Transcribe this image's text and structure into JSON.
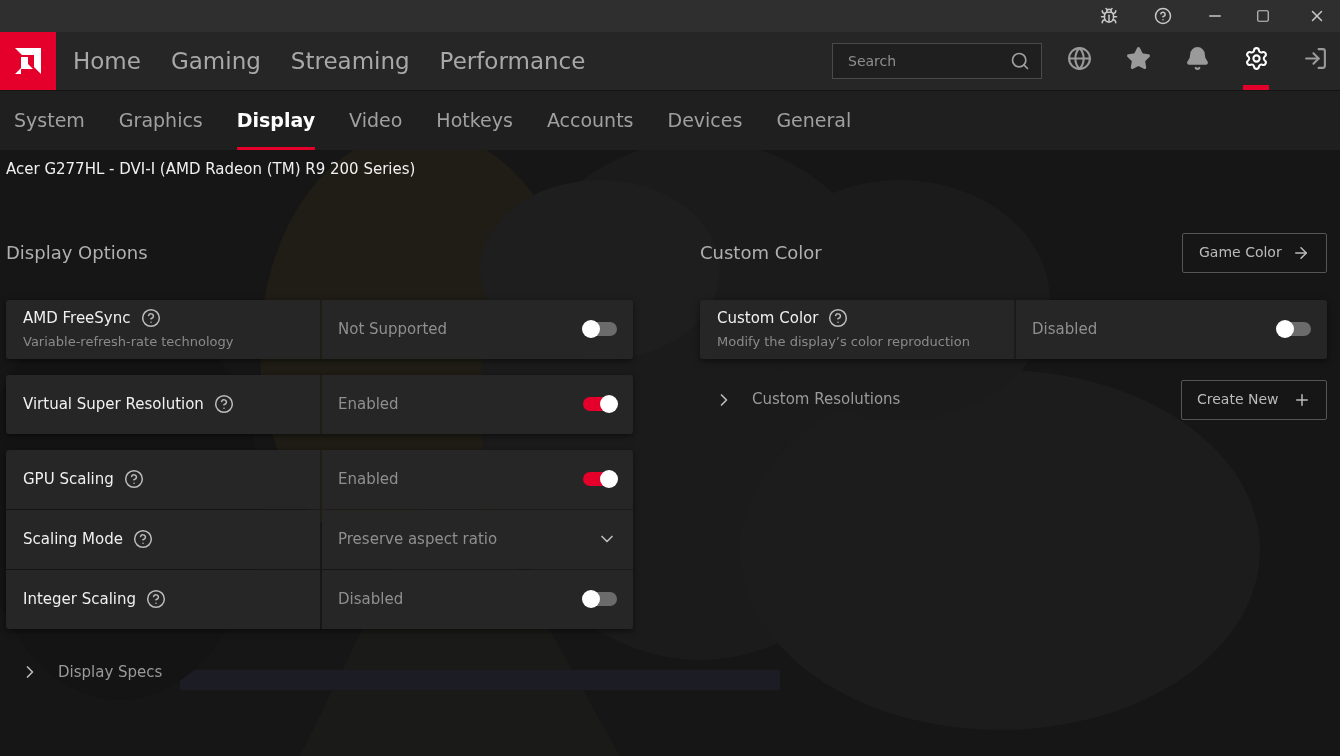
{
  "main_nav": [
    {
      "label": "Home",
      "selected": false
    },
    {
      "label": "Gaming",
      "selected": false
    },
    {
      "label": "Streaming",
      "selected": false
    },
    {
      "label": "Performance",
      "selected": false
    }
  ],
  "search": {
    "placeholder": "Search"
  },
  "toolbar_icons": [
    {
      "kind": "globe",
      "selected": false
    },
    {
      "kind": "star",
      "selected": false
    },
    {
      "kind": "bell",
      "selected": false
    },
    {
      "kind": "gear",
      "selected": true
    },
    {
      "kind": "exit",
      "selected": false
    }
  ],
  "sub_tabs": [
    {
      "label": "System",
      "selected": false
    },
    {
      "label": "Graphics",
      "selected": false
    },
    {
      "label": "Display",
      "selected": true
    },
    {
      "label": "Video",
      "selected": false
    },
    {
      "label": "Hotkeys",
      "selected": false
    },
    {
      "label": "Accounts",
      "selected": false
    },
    {
      "label": "Devices",
      "selected": false
    },
    {
      "label": "General",
      "selected": false
    }
  ],
  "device": "Acer G277HL - DVI-I (AMD Radeon (TM) R9 200 Series)",
  "display_options": {
    "title": "Display Options",
    "groups": [
      [
        {
          "kind": "toggle",
          "label": "AMD FreeSync",
          "description": "Variable-refresh-rate technology",
          "value": "Not Supported",
          "on": false
        }
      ],
      [
        {
          "kind": "toggle",
          "label": "Virtual Super Resolution",
          "value": "Enabled",
          "on": true
        }
      ],
      [
        {
          "kind": "toggle",
          "label": "GPU Scaling",
          "value": "Enabled",
          "on": true
        },
        {
          "kind": "dropdown",
          "label": "Scaling Mode",
          "value": "Preserve aspect ratio"
        },
        {
          "kind": "toggle",
          "label": "Integer Scaling",
          "value": "Disabled",
          "on": false
        }
      ]
    ],
    "expander": {
      "label": "Display Specs",
      "expanded": false
    }
  },
  "custom_color": {
    "title": "Custom Color",
    "button": "Game Color",
    "groups": [
      [
        {
          "kind": "toggle",
          "label": "Custom Color",
          "description": "Modify the display’s color reproduction",
          "value": "Disabled",
          "on": false
        }
      ]
    ],
    "expander": {
      "label": "Custom Resolutions",
      "expanded": false
    },
    "expander_button": "Create New"
  }
}
